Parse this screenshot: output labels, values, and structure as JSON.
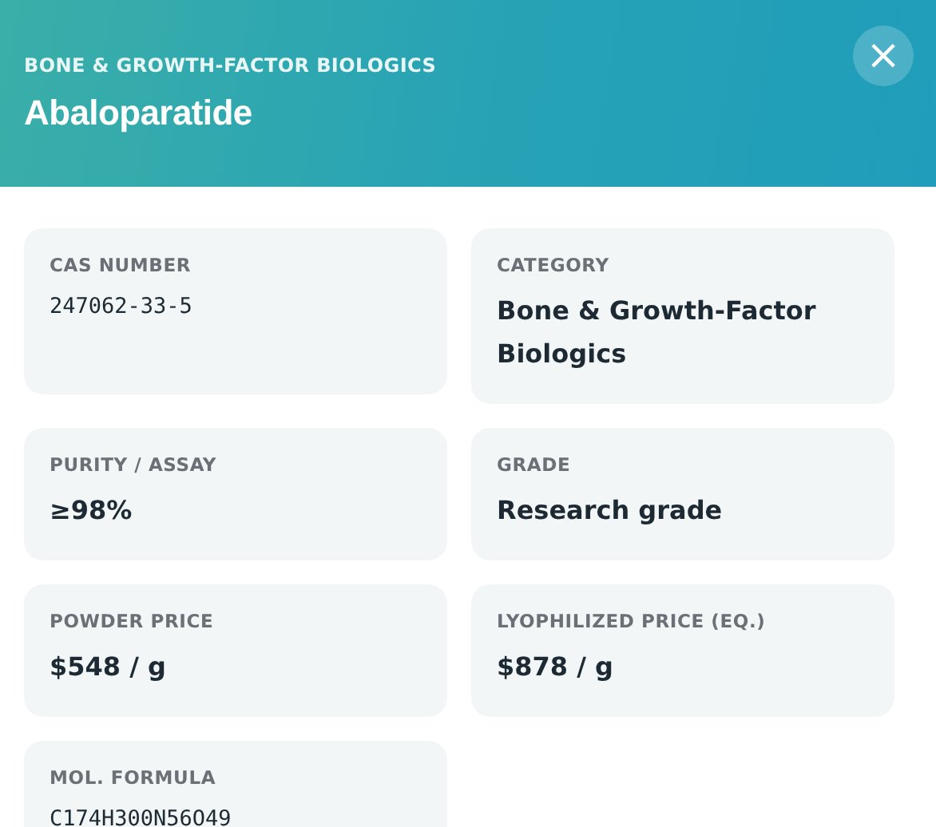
{
  "header": {
    "category": "BONE & GROWTH-FACTOR BIOLOGICS",
    "title": "Abaloparatide",
    "close": "×"
  },
  "fields": [
    {
      "label": "CAS NUMBER",
      "value": "247062-33-5",
      "kind": "mono"
    },
    {
      "label": "CATEGORY",
      "value": "Bone & Growth-Factor Biologics",
      "kind": "text"
    },
    {
      "label": "PURITY / ASSAY",
      "value": "≥98%",
      "kind": "text"
    },
    {
      "label": "GRADE",
      "value": "Research grade",
      "kind": "text"
    },
    {
      "label": "POWDER PRICE",
      "value": "$548 / g",
      "kind": "text"
    },
    {
      "label": "LYOPHILIZED PRICE (EQ.)",
      "value": "$878 / g",
      "kind": "text"
    },
    {
      "label": "MOL. FORMULA",
      "value": "C174H300N56O49",
      "kind": "mono"
    }
  ]
}
